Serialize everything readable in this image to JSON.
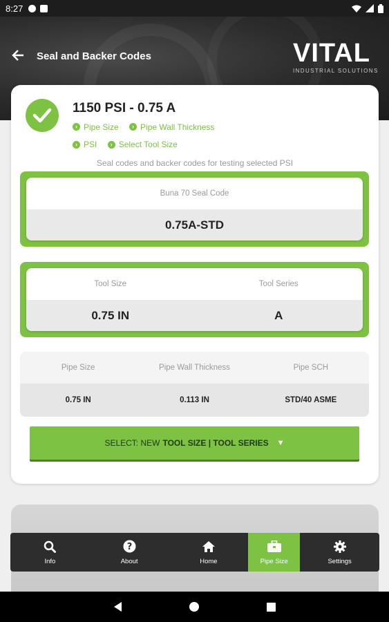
{
  "status_bar": {
    "time": "8:27"
  },
  "header": {
    "title": "Seal and Backer Codes",
    "logo_brand": "VITAL",
    "logo_tagline": "INDUSTRIAL SOLUTIONS"
  },
  "summary": {
    "title": "1150 PSI - 0.75 A",
    "crumbs": [
      "Pipe Size",
      "Pipe Wall Thickness",
      "PSI",
      "Select Tool Size"
    ],
    "subtitle": "Seal codes and backer codes for testing selected PSI"
  },
  "seal_code": {
    "label": "Buna 70 Seal Code",
    "value": "0.75A-STD"
  },
  "tool": {
    "size_label": "Tool Size",
    "size_value": "0.75 IN",
    "series_label": "Tool Series",
    "series_value": "A"
  },
  "pipe": {
    "size_label": "Pipe Size",
    "size_value": "0.75 IN",
    "wall_label": "Pipe Wall Thickness",
    "wall_value": "0.113 IN",
    "sch_label": "Pipe SCH",
    "sch_value": "STD/40 ASME"
  },
  "select_button": {
    "prefix": "SELECT: NEW",
    "bold": "TOOL SIZE | TOOL SERIES"
  },
  "tabs": [
    {
      "label": "Info",
      "icon": "search-icon"
    },
    {
      "label": "About",
      "icon": "question-icon"
    },
    {
      "label": "Home",
      "icon": "home-icon"
    },
    {
      "label": "Pipe Size",
      "icon": "toolbox-icon"
    },
    {
      "label": "Settings",
      "icon": "gear-icon"
    }
  ],
  "colors": {
    "accent": "#7dc242",
    "dark": "#2d2d2d"
  }
}
